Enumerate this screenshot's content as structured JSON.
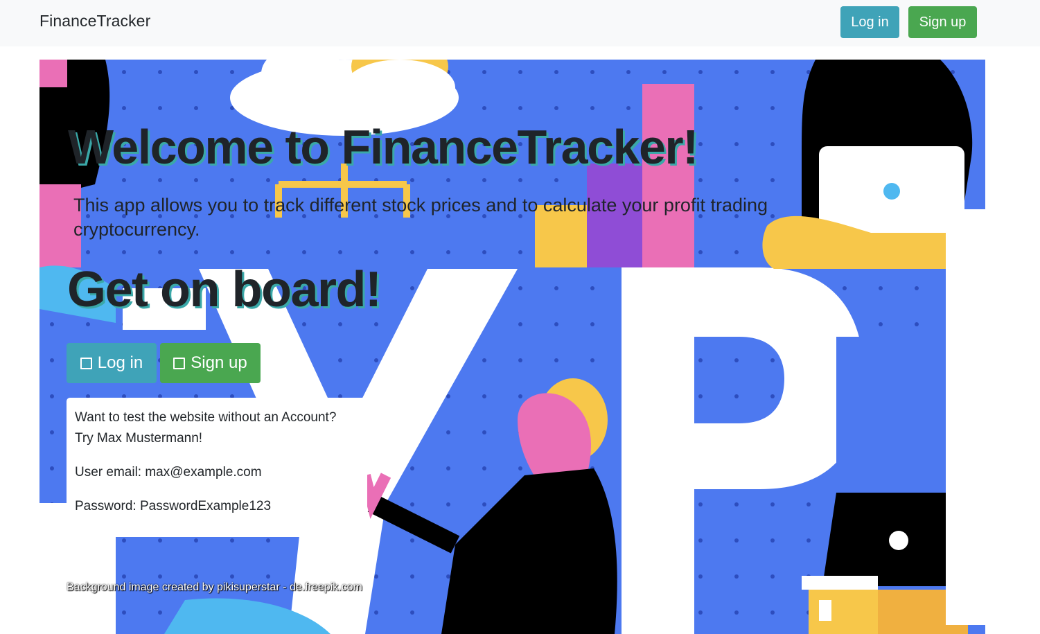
{
  "navbar": {
    "brand": "FinanceTracker",
    "login_label": "Log in",
    "signup_label": "Sign up"
  },
  "hero": {
    "title": "Welcome to FinanceTracker!",
    "lead": "This app allows you to track different stock prices and to calculate your profit trading cryptocurrency.",
    "subtitle": "Get on board!",
    "login_label": "Log in",
    "signup_label": "Sign up",
    "square_icon": "square-icon",
    "test_account": {
      "line1": "Want to test the website without an Account?",
      "line2": "Try Max Mustermann!",
      "email": "User email: max@example.com",
      "password": "Password: PasswordExample123"
    },
    "credit": "Background image created by pikisuperstar - de.freepik.com"
  },
  "colors": {
    "navbar_bg": "#f8f9fa",
    "info": "#3fa3b8",
    "success": "#4aa750",
    "hero_blue": "#4d79f0"
  }
}
